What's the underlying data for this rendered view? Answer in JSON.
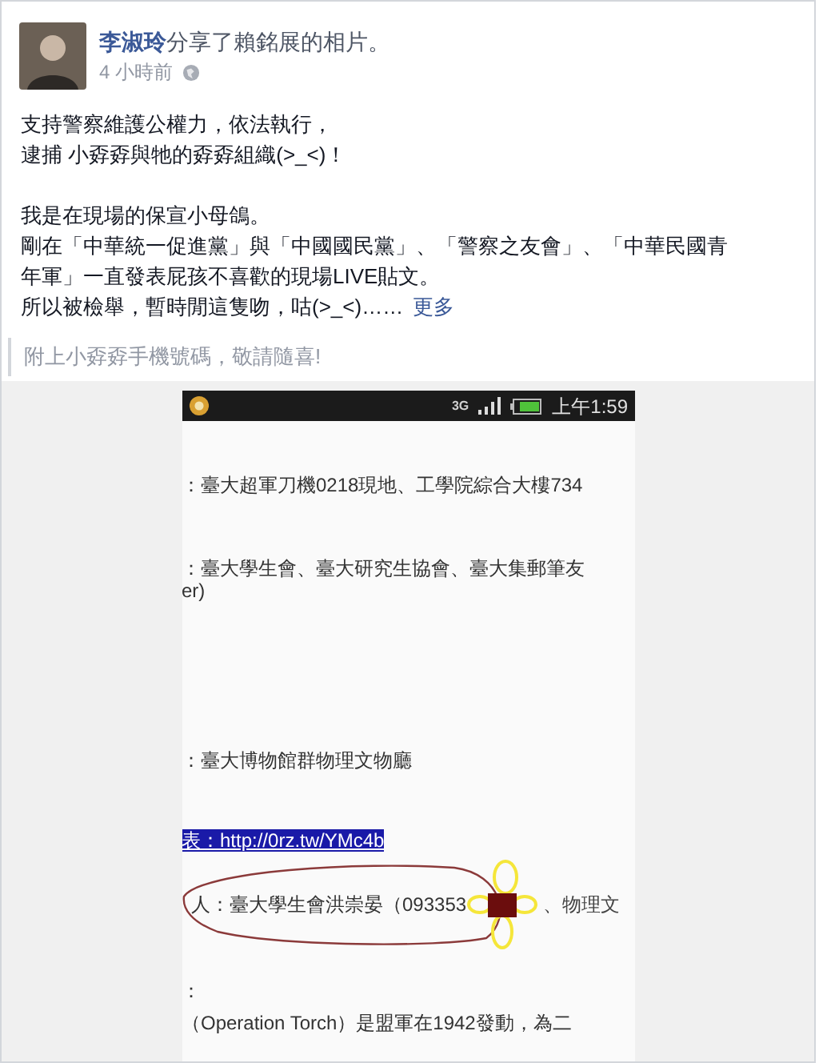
{
  "post": {
    "author": "李淑玲",
    "action": "分享了賴銘展的相片。",
    "time": "4 小時前",
    "paragraphs": [
      [
        "支持警察維護公權力，依法執行，",
        "逮捕 小孬孬與牠的孬孬組織(>_<)！"
      ],
      [
        "我是在現場的保宣小母鴿。",
        "剛在「中華統一促進黨」與「中國國民黨」、「警察之友會」、「中華民國青",
        "年軍」一直發表屁孩不喜歡的現場LIVE貼文。",
        "所以被檢舉，暫時閒這隻吻，咕(>_<)……"
      ]
    ],
    "more": "更多",
    "quote": "附上小孬孬手機號碼，敬請隨喜!"
  },
  "phone": {
    "status": {
      "network": "3G",
      "time": "上午1:59"
    },
    "lines": [
      {
        "kind": "text",
        "text": "：臺大超軍刀機0218現地、工學院綜合大樓734"
      },
      {
        "kind": "text",
        "text": "：臺大學生會、臺大研究生協會、臺大集郵筆友"
      },
      {
        "kind": "text",
        "text": "er)"
      },
      {
        "kind": "text",
        "text": "：臺大博物館群物理文物廳"
      },
      {
        "kind": "link",
        "text": "表：http://0rz.tw/YMc4b"
      },
      {
        "kind": "circled",
        "text": "人：臺大學生會洪崇晏（093353",
        "after": "、物理文"
      },
      {
        "kind": "text",
        "text": "："
      },
      {
        "kind": "text",
        "text": "（Operation Torch）是盟軍在1942發動，為二"
      }
    ]
  }
}
